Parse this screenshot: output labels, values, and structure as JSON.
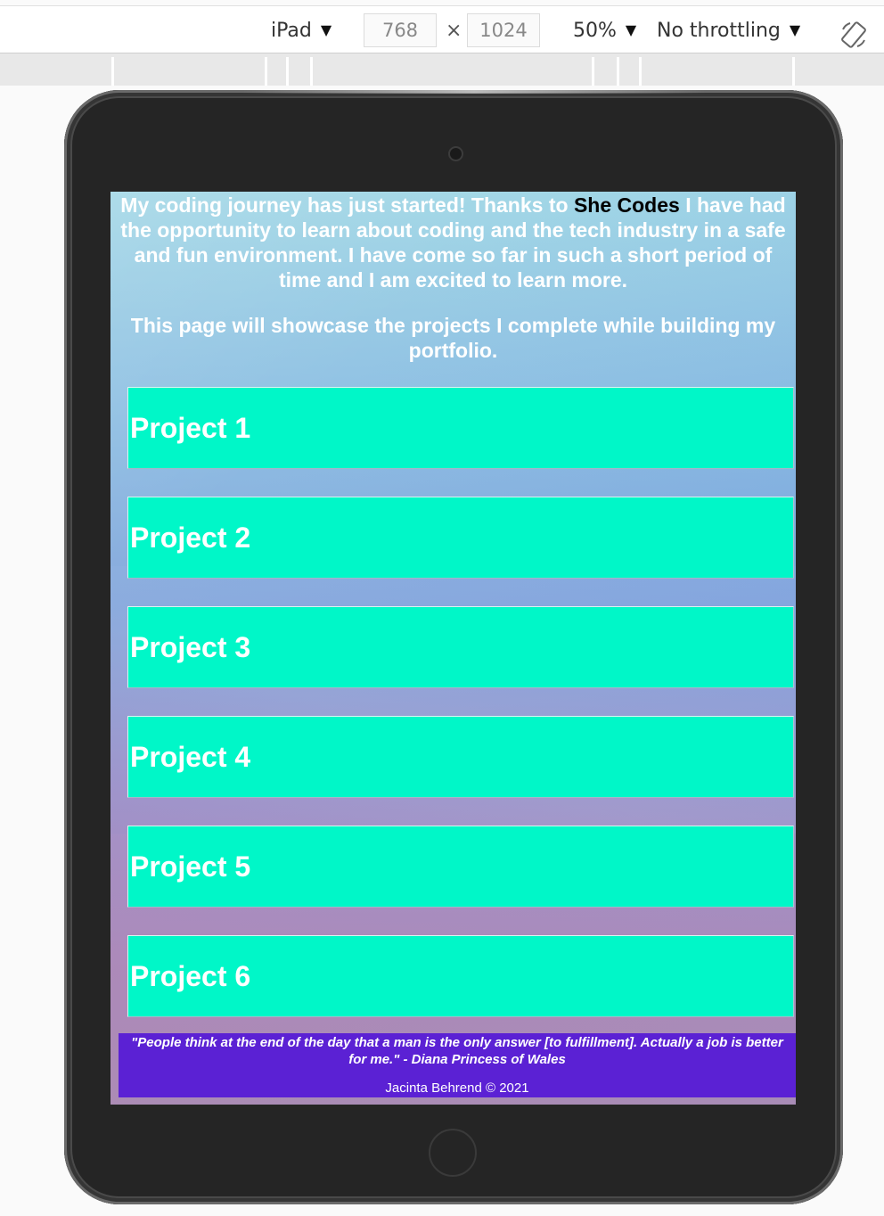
{
  "toolbar": {
    "device": "iPad",
    "width": "768",
    "times": "×",
    "height": "1024",
    "zoom": "50%",
    "throttling": "No throttling",
    "rotate_icon": "rotate-icon"
  },
  "page": {
    "intro_pre": "My coding journey has just started! Thanks to ",
    "intro_brand": "She Codes",
    "intro_post": " I have had the opportunity to learn about coding and the tech industry in a safe and fun environment. I have come so far in such a short period of time and I am excited to learn more.",
    "intro_2": "This page will showcase the projects I complete while building my portfolio.",
    "projects": [
      "Project 1",
      "Project 2",
      "Project 3",
      "Project 4",
      "Project 5",
      "Project 6"
    ],
    "quote": "\"People think at the end of the day that a man is the only answer [to fulfillment]. Actually a job is better for me.\" - Diana Princess of Wales",
    "credit": "Jacinta Behrend © 2021"
  },
  "colors": {
    "project_bg": "#00f7c8",
    "footer_bg": "#5b21d4",
    "brand_text": "#000000"
  }
}
